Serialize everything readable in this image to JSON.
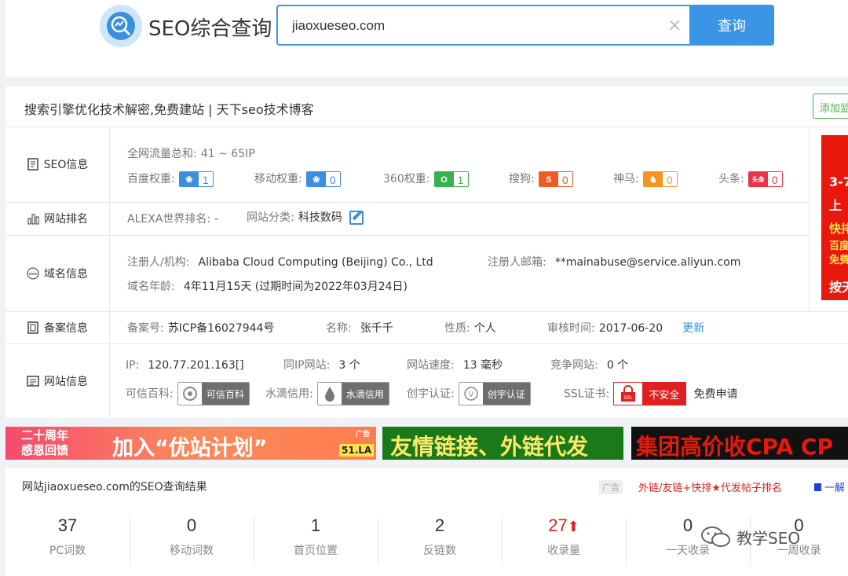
{
  "header": {
    "logo_text": "SEO综合查询",
    "search_value": "jiaoxueseo.com",
    "search_button": "查询"
  },
  "site": {
    "title": "搜索引擎优化技术解密,免费建站 | 天下seo技术博客",
    "add_monitor": "添加监"
  },
  "seo_info": {
    "label": "SEO信息",
    "traffic_label": "全网流量总和:",
    "traffic_value": "41 ~ 65IP",
    "baidu_label": "百度权重:",
    "baidu_value": "1",
    "mobile_label": "移动权重:",
    "mobile_value": "0",
    "s360_label": "360权重:",
    "s360_value": "1",
    "sogou_label": "搜狗:",
    "sogou_value": "0",
    "shenma_label": "神马:",
    "shenma_value": "0",
    "toutiao_label": "头条:",
    "toutiao_value": "0",
    "toutiao_icon_text": "头条"
  },
  "rank": {
    "label": "网站排名",
    "alexa_label": "ALEXA世界排名:",
    "alexa_value": "-",
    "category_label": "网站分类:",
    "category_value": "科技数码"
  },
  "domain": {
    "label": "域名信息",
    "registrant_label": "注册人/机构:",
    "registrant_value": "Alibaba Cloud Computing (Beijing) Co., Ltd",
    "email_label": "注册人邮箱:",
    "email_value": "**mainabuse@service.aliyun.com",
    "age_label": "域名年龄:",
    "age_value": "4年11月15天 (过期时间为2022年03月24日)"
  },
  "icp": {
    "label": "备案信息",
    "number_label": "备案号:",
    "number_value": "苏ICP备16027944号",
    "name_label": "名称:",
    "name_value": "张千千",
    "nature_label": "性质:",
    "nature_value": "个人",
    "audit_label": "审核时间:",
    "audit_value": "2017-06-20",
    "update_link": "更新"
  },
  "webinfo": {
    "label": "网站信息",
    "ip_label": "IP:",
    "ip_value": "120.77.201.163[]",
    "same_ip_label": "同IP网站:",
    "same_ip_value": "3 个",
    "speed_label": "网站速度:",
    "speed_value": "13 毫秒",
    "competitor_label": "竞争网站:",
    "competitor_value": "0 个",
    "kexin_label": "可信百科:",
    "kexin_badge": "可信百科",
    "shuidi_label": "水滴信用:",
    "shuidi_badge": "水滴信用",
    "chuangyu_label": "创宇认证:",
    "chuangyu_badge": "创宇认证",
    "ssl_label": "SSL证书:",
    "ssl_badge": "不安全",
    "ssl_badge_icon": "SSL",
    "ssl_apply": "免费申请"
  },
  "side_ad": {
    "line1": "3-7",
    "line2": "上",
    "line3": "快排",
    "line4": "百度",
    "line5": "免费",
    "line6": "按天"
  },
  "banners": {
    "b1_left_top": "二十周年",
    "b1_left_bottom": "感恩回馈",
    "b1_main": "加入“优站计划”",
    "b1_tag": "广告",
    "b1_brand": "51.LA",
    "b2_main": "友情链接、外链代发",
    "b3_main": "集团高价收CPA CP"
  },
  "results": {
    "title": "网站jiaoxueseo.com的SEO查询结果",
    "ad_tag": "广告",
    "ad_link": "外链/友链+快排★代发帖子排名",
    "ad_link2": "一解",
    "stats": [
      {
        "value": "37",
        "caption": "PC词数",
        "highlight": false
      },
      {
        "value": "0",
        "caption": "移动词数",
        "highlight": false
      },
      {
        "value": "1",
        "caption": "首页位置",
        "highlight": false
      },
      {
        "value": "2",
        "caption": "反链数",
        "highlight": false
      },
      {
        "value": "27",
        "caption": "收录量",
        "highlight": true
      },
      {
        "value": "0",
        "caption": "一天收录",
        "highlight": false
      },
      {
        "value": "0",
        "caption": "一周收录",
        "highlight": false
      }
    ]
  },
  "watermark": "教学SEO",
  "colors": {
    "primary": "#3b95e6",
    "danger": "#e02020",
    "success": "#4caf50"
  }
}
